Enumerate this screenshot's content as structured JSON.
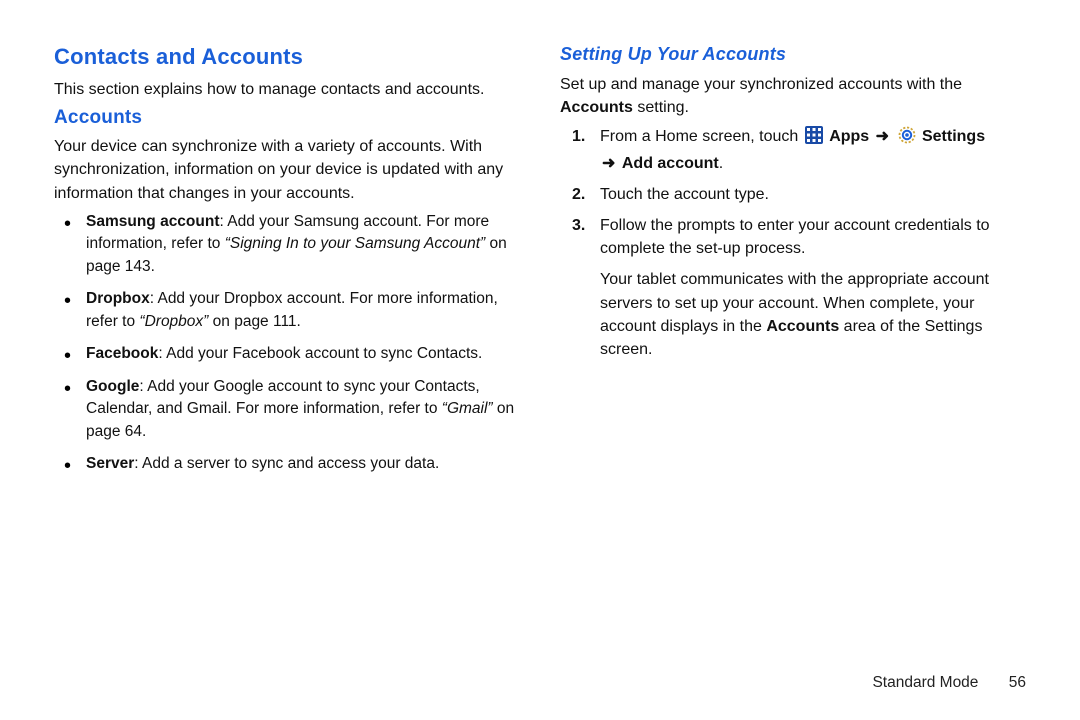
{
  "left": {
    "title": "Contacts and Accounts",
    "intro": "This section explains how to manage contacts and accounts.",
    "subhead": "Accounts",
    "accounts_intro": "Your device can synchronize with a variety of accounts. With synchronization, information on your device is updated with any information that changes in your accounts.",
    "bullets": {
      "b0": {
        "label": "Samsung account",
        "text": ": Add your Samsung account. For more information, refer to ",
        "ref": "“Signing In to your Samsung Account”",
        "tail": " on page 143."
      },
      "b1": {
        "label": "Dropbox",
        "text": ": Add your Dropbox account. For more information, refer to ",
        "ref": "“Dropbox”",
        "tail": " on page 111."
      },
      "b2": {
        "label": "Facebook",
        "text": ": Add your Facebook account to sync Contacts."
      },
      "b3": {
        "label": "Google",
        "text": ": Add your Google account to sync your Contacts, Calendar, and Gmail. For more information, refer to ",
        "ref": "“Gmail”",
        "tail": " on page 64."
      },
      "b4": {
        "label": "Server",
        "text": ": Add a server to sync and access your data."
      }
    }
  },
  "right": {
    "subhead": "Setting Up Your Accounts",
    "intro_lead": "Set up and manage your synchronized accounts with the ",
    "intro_bold": "Accounts",
    "intro_tail": " setting.",
    "step1": {
      "lead": "From a Home screen, touch ",
      "apps_label": "Apps",
      "arrow": "➜",
      "settings_label": "Settings",
      "arrow2": "➜",
      "add_account": "Add account",
      "period": "."
    },
    "step2": "Touch the account type.",
    "step3": "Follow the prompts to enter your account credentials to complete the set-up process.",
    "outro_a": "Your tablet communicates with the appropriate account servers to set up your account. When complete, your account displays in the ",
    "outro_bold": "Accounts",
    "outro_b": " area of the Settings screen."
  },
  "footer": {
    "mode": "Standard Mode",
    "page": "56"
  }
}
